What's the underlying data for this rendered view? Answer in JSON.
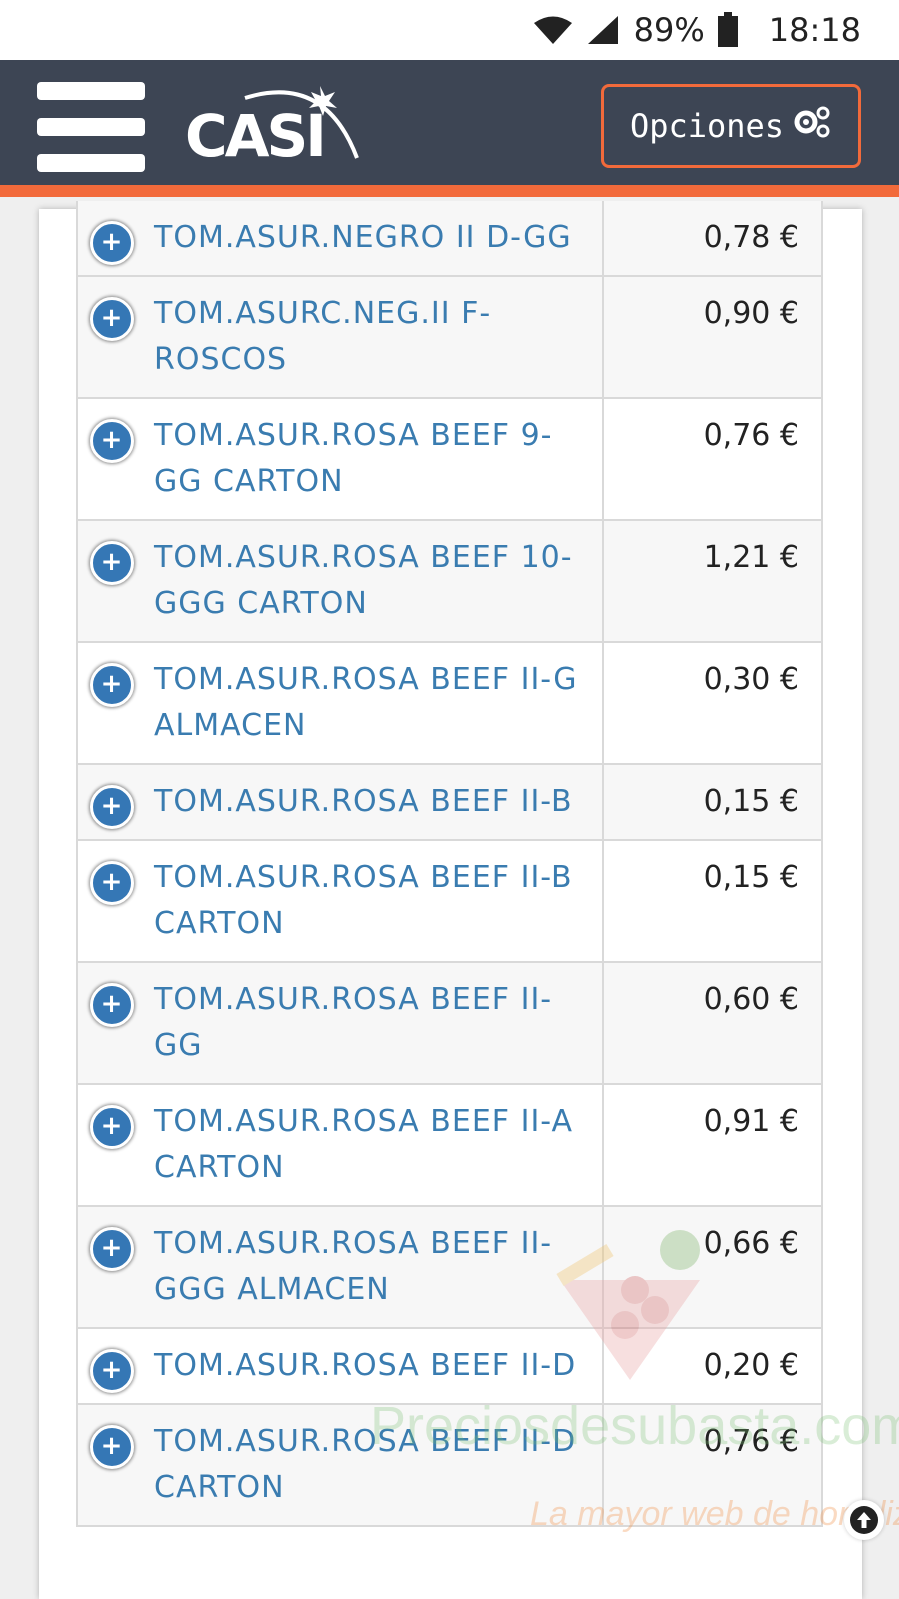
{
  "status_bar": {
    "battery_percent": "89%",
    "time": "18:18"
  },
  "header": {
    "logo_text": "CASI",
    "options_label": "Opciones",
    "accent_color": "#f26a3b",
    "background_color": "#3d4554"
  },
  "products": [
    {
      "name": "TOM.ASUR.NEGRO II D-GG",
      "price": "0,78 €"
    },
    {
      "name": "TOM.ASURC.NEG.II F-ROSCOS",
      "price": "0,90 €"
    },
    {
      "name": "TOM.ASUR.ROSA BEEF 9-GG CARTON",
      "price": "0,76 €"
    },
    {
      "name": "TOM.ASUR.ROSA BEEF 10-GGG CARTON",
      "price": "1,21 €"
    },
    {
      "name": "TOM.ASUR.ROSA BEEF II-G ALMACEN",
      "price": "0,30 €"
    },
    {
      "name": "TOM.ASUR.ROSA BEEF II-B",
      "price": "0,15 €"
    },
    {
      "name": "TOM.ASUR.ROSA BEEF II-B CARTON",
      "price": "0,15 €"
    },
    {
      "name": "TOM.ASUR.ROSA BEEF II-GG",
      "price": "0,60 €"
    },
    {
      "name": "TOM.ASUR.ROSA BEEF II-A CARTON",
      "price": "0,91 €"
    },
    {
      "name": "TOM.ASUR.ROSA BEEF II-GGG ALMACEN",
      "price": "0,66 €"
    },
    {
      "name": "TOM.ASUR.ROSA BEEF II-D",
      "price": "0,20 €"
    },
    {
      "name": "TOM.ASUR.ROSA BEEF II-D CARTON",
      "price": "0,76 €"
    }
  ],
  "watermark": {
    "site": "Preciosdesubasta.com",
    "tagline": "La mayor web de hortaliza"
  },
  "icons": {
    "expand": "plus-circle-icon",
    "options": "gears-icon",
    "scroll_top": "arrow-up-circle-icon"
  }
}
